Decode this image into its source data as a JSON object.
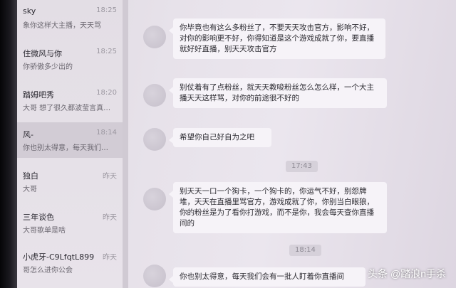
{
  "sidebar": {
    "conversations": [
      {
        "name": "sky",
        "preview": "象你这样大主播，天天骂",
        "time": "18:25"
      },
      {
        "name": "住微风与你",
        "preview": "你骄傲多少出的",
        "time": "18:25"
      },
      {
        "name": "踏姆吧秀",
        "preview": "大哥 想了很久都波莹言真…",
        "time": "18:20"
      },
      {
        "name": "风-",
        "preview": "你也别太得意，每天我们…",
        "time": "18:14"
      },
      {
        "name": "独白",
        "preview": "大哥",
        "time": "昨天"
      },
      {
        "name": "三年谈色",
        "preview": "大哥歌单是啥",
        "time": "昨天"
      },
      {
        "name": "小虎牙-C9LfqtL899",
        "preview": "哥怎么进你公会",
        "time": "昨天"
      }
    ]
  },
  "chat": {
    "timestamps": [
      "17:43",
      "18:14"
    ],
    "messages": [
      {
        "text": "你毕竟也有这么多粉丝了，不要天天攻击官方，影响不好，对你的影响更不好，你得知道是这个游戏成就了你，要直播就好好直播，别天天攻击官方"
      },
      {
        "text": "别仗着有了点粉丝，就天天教唆粉丝怎么怎么样，一个大主播天天这样骂，对你的前途很不好的"
      },
      {
        "text": "希望你自己好自为之吧"
      },
      {
        "text": "别天天一口一个狗卡，一个狗卡的，你运气不好，别怨牌堆，天天在直播里骂官方，游戏成就了你，你别当白眼狼，你的粉丝是为了看你打游戏，而不是你，我会每天查你直播间的"
      },
      {
        "text": "你也别太得意，每天我们会有一批人盯着你直播间"
      }
    ]
  },
  "watermark": {
    "text": "头条 @踏浪n手杀"
  }
}
